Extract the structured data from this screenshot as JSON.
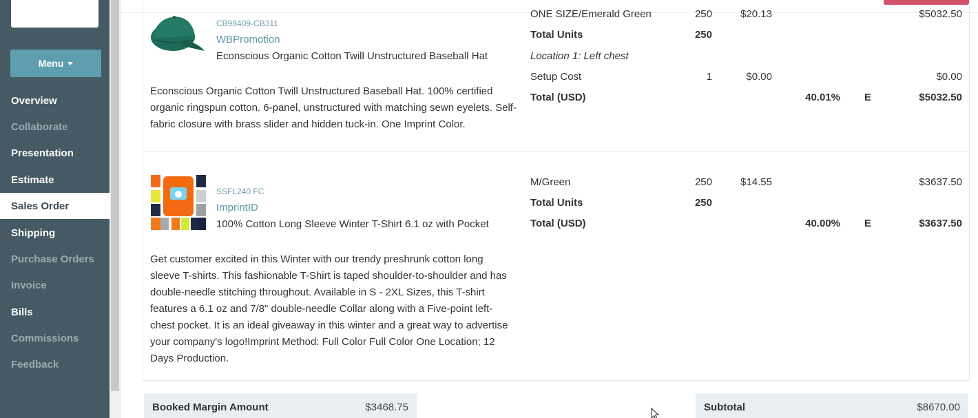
{
  "sidebar": {
    "menu_label": "Menu",
    "items": [
      {
        "label": "Overview",
        "state": "normal"
      },
      {
        "label": "Collaborate",
        "state": "muted"
      },
      {
        "label": "Presentation",
        "state": "normal"
      },
      {
        "label": "Estimate",
        "state": "normal"
      },
      {
        "label": "Sales Order",
        "state": "active"
      },
      {
        "label": "Shipping",
        "state": "normal"
      },
      {
        "label": "Purchase Orders",
        "state": "muted"
      },
      {
        "label": "Invoice",
        "state": "muted"
      },
      {
        "label": "Bills",
        "state": "normal"
      },
      {
        "label": "Commissions",
        "state": "muted"
      },
      {
        "label": "Feedback",
        "state": "muted"
      }
    ]
  },
  "products": [
    {
      "sku": "CB98409-CB311",
      "supplier": "WBPromotion",
      "name": "Econscious Organic Cotton Twill Unstructured Baseball Hat",
      "description": "Econscious Organic Cotton Twill Unstructured Baseball Hat. 100% certified organic ringspun cotton. 6-panel, unstructured with matching sewn eyelets. Self-fabric closure with brass slider and hidden tuck-in. One Imprint Color.",
      "lines": {
        "variant": {
          "label": "ONE SIZE/Emerald Green",
          "qty": "250",
          "price": "$20.13",
          "total": "$5032.50"
        },
        "total_units": {
          "label": "Total Units",
          "qty": "250"
        },
        "location": "Location 1: Left chest",
        "setup": {
          "label": "Setup Cost",
          "qty": "1",
          "price": "$0.00",
          "total": "$0.00"
        },
        "grand": {
          "label": "Total (USD)",
          "margin": "40.01%",
          "tax": "E",
          "total": "$5032.50"
        }
      }
    },
    {
      "sku": "SSFL240 FC",
      "supplier": "ImprintID",
      "name": "100% Cotton Long Sleeve Winter T-Shirt 6.1 oz with Pocket",
      "description": "Get customer excited in this Winter with our trendy preshrunk cotton long sleeve T-shirts. This fashionable T-Shirt is taped shoulder-to-shoulder and has double-needle stitching throughout. Available in S - 2XL Sizes, this T-shirt features a 6.1 oz and 7/8\" double-needle Collar along with a Five-point left-chest pocket. It is an ideal giveaway in this winter and a great way to advertise your company's logo!Imprint Method: Full Color Full Color One Location; 12 Days Production.",
      "lines": {
        "variant": {
          "label": "M/Green",
          "qty": "250",
          "price": "$14.55",
          "total": "$3637.50"
        },
        "total_units": {
          "label": "Total Units",
          "qty": "250"
        },
        "grand": {
          "label": "Total (USD)",
          "margin": "40.00%",
          "tax": "E",
          "total": "$3637.50"
        }
      }
    }
  ],
  "summary": {
    "booked_margin_label": "Booked Margin Amount",
    "booked_margin_value": "$3468.75",
    "subtotal_label": "Subtotal",
    "subtotal_value": "$8670.00"
  },
  "colors": {
    "sidebar": "#455a64",
    "menu_button": "#5e9eae",
    "accent_button": "#d1556a",
    "link": "#5b95a6"
  }
}
